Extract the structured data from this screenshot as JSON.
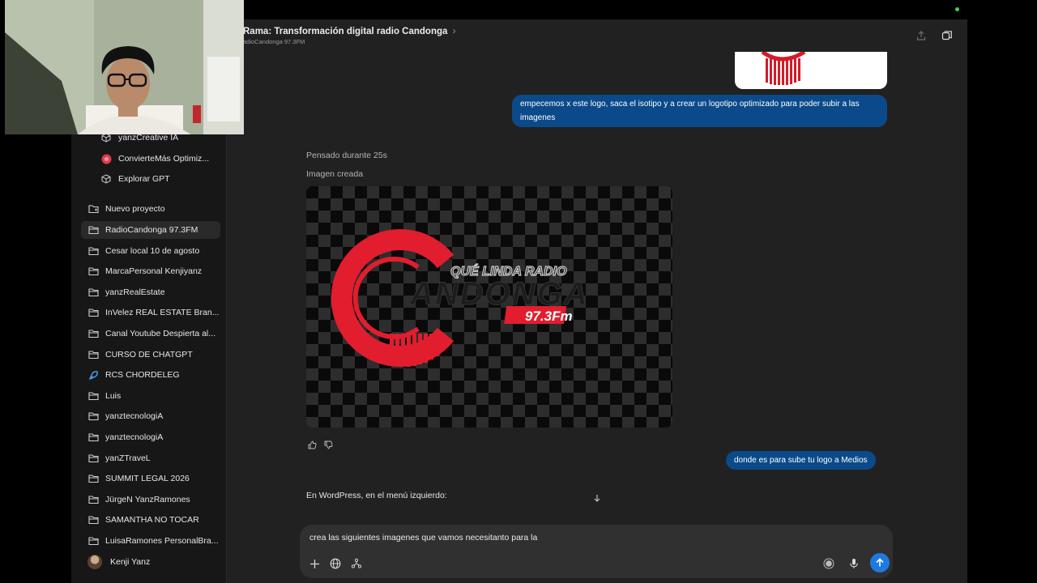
{
  "header": {
    "title": "Rama: Transformación digital radio Candonga",
    "title_chevron": "›",
    "subtitle": "adioCandonga 97.3FM"
  },
  "sidebar": {
    "gpts": [
      {
        "label": "yanzCreative IA",
        "icon": "cube-icon"
      },
      {
        "label": "ConvierteMás Optimiz...",
        "icon": "red-circle-icon"
      },
      {
        "label": "Explorar GPT",
        "icon": "cube-icon"
      }
    ],
    "new_project_label": "Nuevo proyecto",
    "projects": [
      {
        "label": "RadioCandonga 97.3FM",
        "active": true,
        "icon": "folder-icon"
      },
      {
        "label": "Cesar local 10 de agosto",
        "icon": "folder-icon"
      },
      {
        "label": "MarcaPersonal Kenjiyanz",
        "icon": "folder-icon"
      },
      {
        "label": "yanzRealEstate",
        "icon": "folder-icon"
      },
      {
        "label": "InVelez REAL ESTATE Bran...",
        "icon": "folder-icon"
      },
      {
        "label": "Canal Youtube Despierta al...",
        "icon": "folder-icon"
      },
      {
        "label": "CURSO DE CHATGPT",
        "icon": "folder-icon"
      },
      {
        "label": "RCS CHORDELEG",
        "icon": "blue-shape-icon"
      },
      {
        "label": "Luis",
        "icon": "folder-icon"
      },
      {
        "label": "yanztecnologiA",
        "icon": "folder-icon"
      },
      {
        "label": "yanztecnologiA",
        "icon": "folder-icon"
      },
      {
        "label": "yanZTraveL",
        "icon": "folder-icon"
      },
      {
        "label": "SUMMIT LEGAL 2026",
        "icon": "folder-icon"
      },
      {
        "label": "JürgeN YanzRamones",
        "icon": "folder-icon"
      },
      {
        "label": "SAMANTHA NO TOCAR",
        "icon": "folder-icon"
      },
      {
        "label": "LuisaRamones PersonalBra...",
        "icon": "folder-icon"
      }
    ],
    "user_name": "Kenji Yanz"
  },
  "chat": {
    "user_message_1": "empecemos x este logo, saca el isotipo y a crear un logotipo optimizado para poder subir a las imagenes",
    "thought_label": "Pensado durante 25s",
    "image_label": "Imagen creada",
    "generated_logo": {
      "tagline": "QUÉ LINDA RADIO",
      "wordmark": "ANDONGA",
      "frequency": "97.3Fm",
      "brand_color": "#e11d2e"
    },
    "user_message_2": "donde es para sube tu logo a Medios",
    "assistant_partial": "En WordPress, en el menú izquierdo:",
    "scroll_down_icon": "arrow-down-icon"
  },
  "composer": {
    "value": "crea las siguientes imagenes que vamos necesitanto para la",
    "send_color": "#1f7ae0"
  },
  "colors": {
    "user_bubble": "#0b4a8a",
    "sidebar_bg": "#171717",
    "main_bg": "#212121",
    "status_dot": "#3ad34a"
  }
}
